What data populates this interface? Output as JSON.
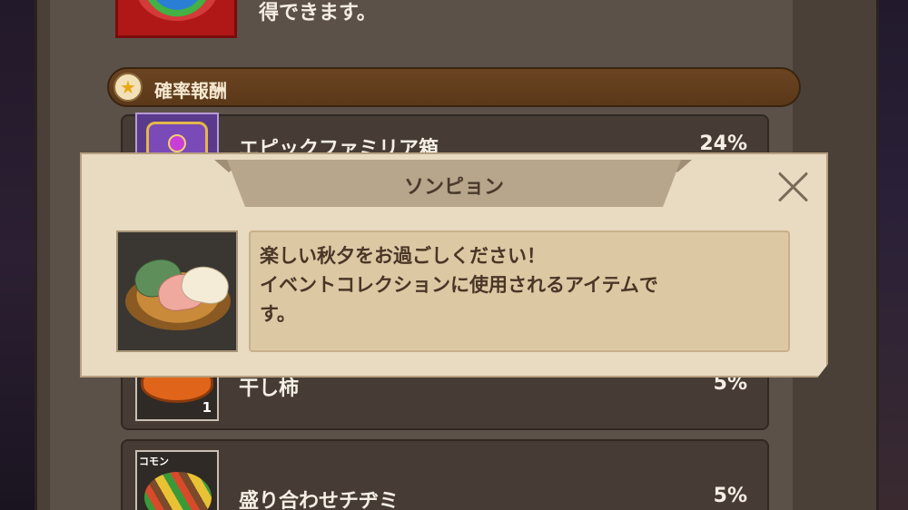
{
  "top_item": {
    "description_tail": "得できます。"
  },
  "section": {
    "title": "確率報酬",
    "icon": "star-icon"
  },
  "rewards": [
    {
      "name": "エピックファミリア箱",
      "chance": "24%"
    },
    {
      "name": "干し柿",
      "chance": "5%",
      "quantity": "1"
    },
    {
      "name": "盛り合わせチヂミ",
      "chance": "5%",
      "rarity": "コモン"
    }
  ],
  "popup": {
    "title": "ソンピョン",
    "description": [
      "楽しい秋夕をお過ごしください！",
      "イベントコレクションに使用されるアイテムで",
      "す。"
    ],
    "close_icon": "close-icon"
  }
}
